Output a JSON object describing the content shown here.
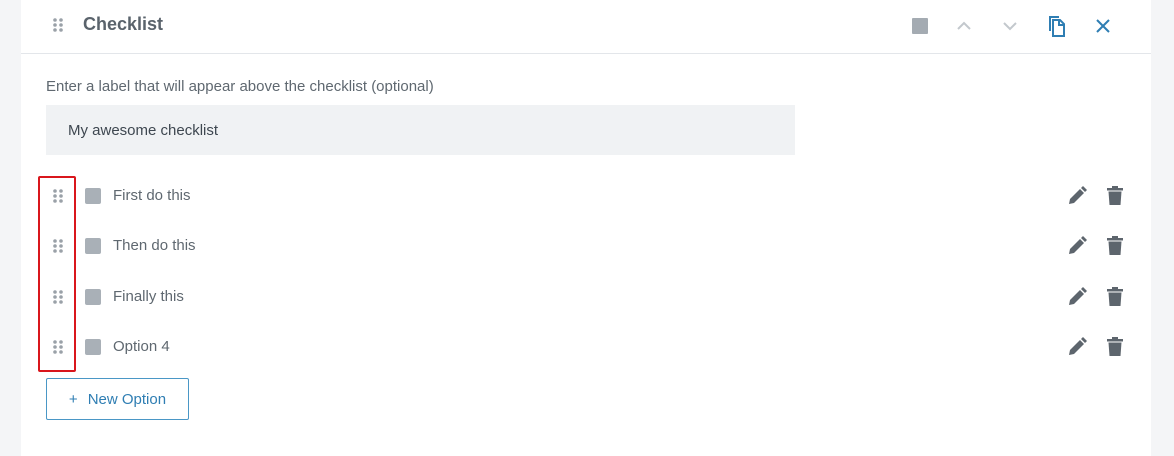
{
  "header": {
    "title": "Checklist",
    "icons": [
      "drag-handle-icon",
      "square-icon",
      "chevron-up-icon",
      "chevron-down-icon",
      "copy-icon",
      "close-icon"
    ]
  },
  "label_field": {
    "prompt": "Enter a label that will appear above the checklist (optional)",
    "value": "My awesome checklist"
  },
  "options": [
    {
      "label": "First do this"
    },
    {
      "label": "Then do this"
    },
    {
      "label": "Finally this"
    },
    {
      "label": "Option 4"
    }
  ],
  "new_option": {
    "icon": "+",
    "label": "New Option"
  },
  "colors": {
    "accent": "#2f7eb3",
    "highlight": "#d9161c",
    "icon_gray": "#5d656d",
    "checkbox": "#a9b0b7"
  }
}
